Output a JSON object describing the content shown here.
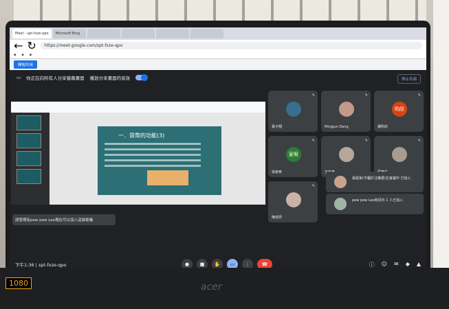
{
  "browser": {
    "tabs": [
      "Meet - spt-fxze-qpo",
      "Microsoft Bing",
      "",
      "",
      "",
      ""
    ],
    "url": "https://meet.google.com/spt-fxze-qpo",
    "notice_button": "開始共用"
  },
  "meet": {
    "present_label": "停止共用",
    "presenting_label": "你正在向所有人分享螢幕畫面",
    "audio_toggle_label": "播放分享畫面的音效",
    "slide_title": "一．貨幣的功能(3)",
    "toast": "朋發現有pew pew Lee現在可以加入這個會議",
    "tiles": [
      {
        "name": "黃子翔"
      },
      {
        "name": "Mingjun Deng"
      },
      {
        "name": "楊昀欣",
        "letter": "昀欣"
      },
      {
        "name": "徐家宥",
        "letter": "家宥"
      },
      {
        "name": "王有宥"
      },
      {
        "name": "蘇彥佑"
      },
      {
        "name": "陳佳妤"
      }
    ],
    "notif_1": "張姐家(不屬於汪橫選)在會議中 已加入",
    "notif_2": "pew pew Lee和另外 1 人已加入",
    "clock": "下午1:36",
    "meeting_code": "spt-fxze-qpo"
  },
  "hardware": {
    "brand": "acer",
    "res_label": "1080"
  }
}
